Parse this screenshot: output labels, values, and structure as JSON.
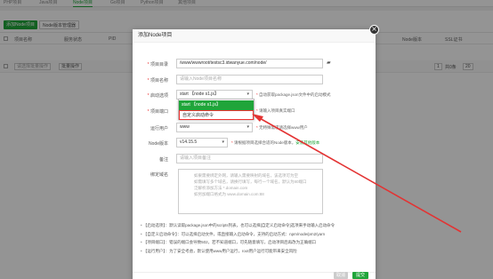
{
  "bg": {
    "tabs": [
      "PHP项目",
      "Java项目",
      "Node项目",
      "Go项目",
      "Python项目",
      "其他项目"
    ],
    "toolbar": {
      "add_label": "添加Node项目",
      "manager_label": "Node版本管理器"
    },
    "columns": [
      "项目名称",
      "服务状态",
      "PID",
      "Node版本",
      "SSL证书"
    ],
    "batch_select": "请选择批量操作",
    "batch_btn": "批量操作",
    "page_num": "1",
    "page_total": "共0条",
    "page_size": "20"
  },
  "dialog": {
    "title": "添加Node项目",
    "fields": {
      "dir": {
        "label": "项目目录",
        "value": "/www/wwwroot/testsc3.idwanyue.com/node/"
      },
      "name": {
        "label": "项目名称",
        "placeholder": "请输入Node项目名称"
      },
      "start": {
        "label": "启动选项",
        "value": "start 【node s1.js】",
        "hint": "自动获取package.json文件中的启动模式"
      },
      "port": {
        "label": "项目端口",
        "hint": "请输入项目真实端口"
      },
      "user": {
        "label": "运行用户",
        "value": "www",
        "hint": "无特殊需求请选择www用户"
      },
      "node_version": {
        "label": "Node版本",
        "value": "v14.15.5",
        "hint_warn": "请根据项目选择合适的Node版本，",
        "hint_link": "安装其他版本"
      },
      "remark": {
        "label": "备注",
        "placeholder": "请输入项目备注"
      },
      "domain": {
        "label": "绑定域名",
        "placeholder_lines": [
          "如果需要绑定外网，请输入需要映射的域名，该选项可为空",
          "如需填写多个域名，请换行填写，每行一个域名，默认为80端口",
          "泛解析添加方法 *.domain.com",
          "如另加端口格式为 www.domain.com:88"
        ]
      }
    },
    "dropdown": {
      "selected": "start 【node s1.js】",
      "option": "自定义启动命令"
    },
    "tips": [
      "【启动选项】：默认读取package.json中的scripts列表，也可以选择[自定义启动命令]选项来手动输入启动命令",
      "【自定义启动命令】：可以选择启动文件，或直接输入启动命令，支持的启动方式：npm/node/pm2/yarn",
      "【项目端口】：错误的端口会导致502，若不知道端口，可先随意填写，启动项目后再改为正确端口",
      "【运行用户】：为了安全考虑，默认使用www用户运行，root用户运行可能带来安全风险"
    ],
    "cancel_label": "取消",
    "submit_label": "提交"
  },
  "colors": {
    "accent": "#20a53a",
    "danger": "#e33333"
  }
}
